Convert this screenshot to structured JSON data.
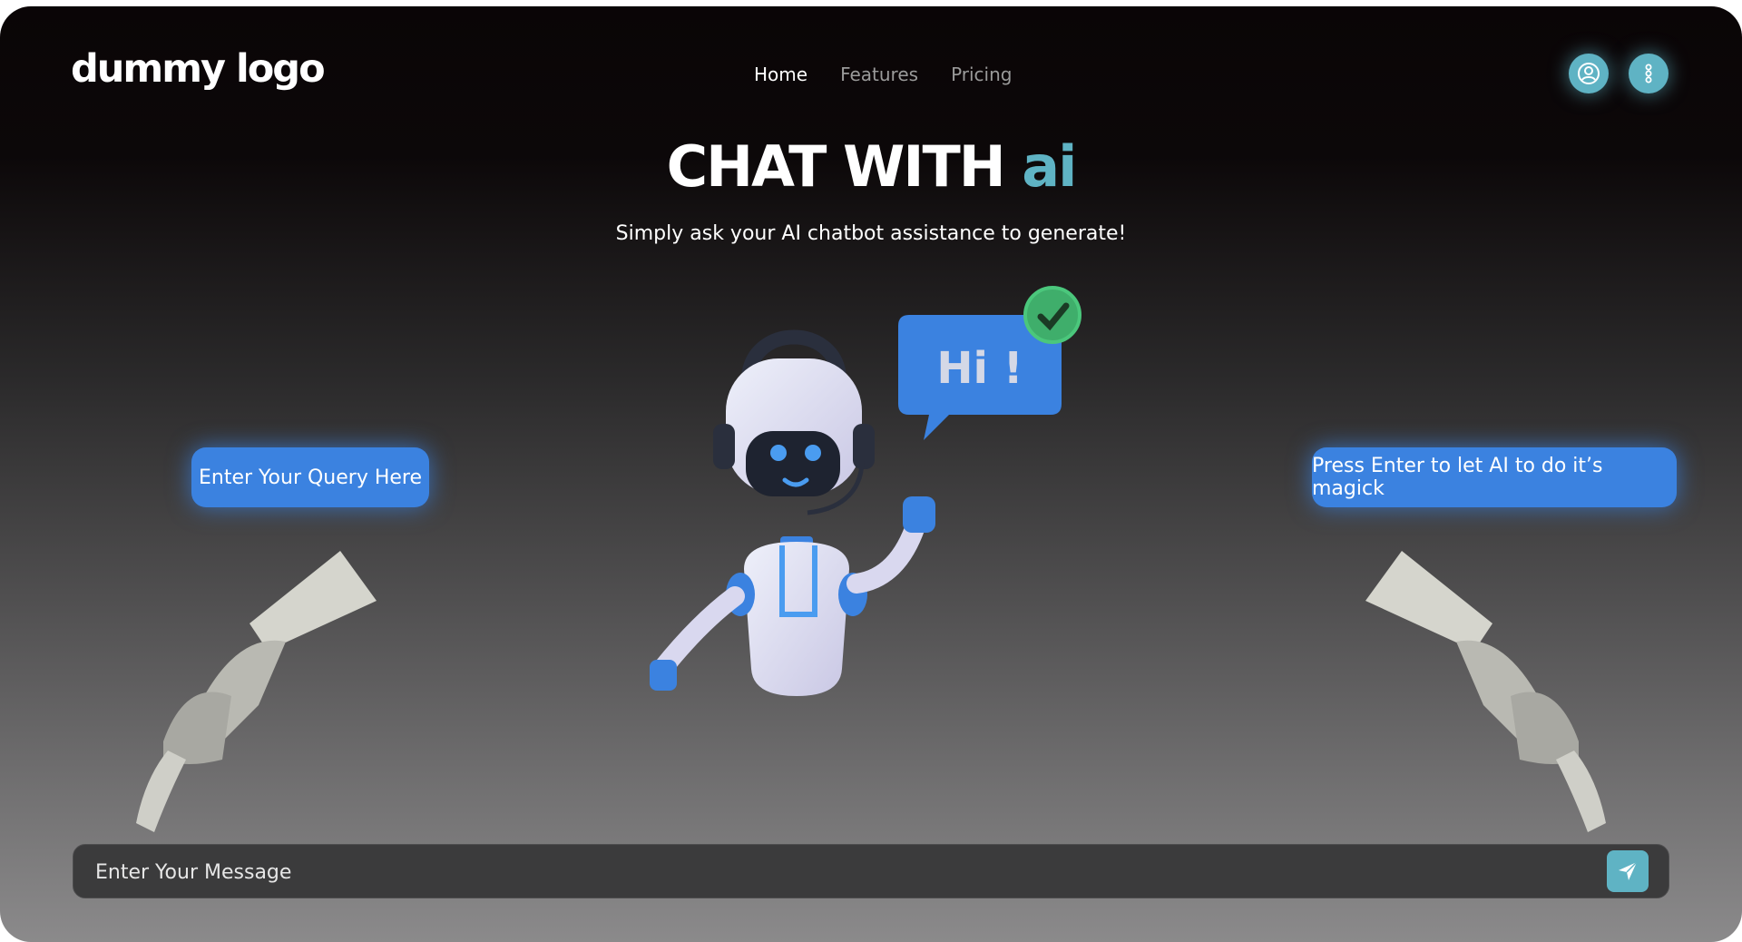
{
  "logo": {
    "text": "dummy logo"
  },
  "nav": {
    "items": [
      {
        "label": "Home",
        "active": true
      },
      {
        "label": "Features",
        "active": false
      },
      {
        "label": "Pricing",
        "active": false
      }
    ]
  },
  "header_icons": {
    "user": "user-circle-icon",
    "menu": "vertical-dots-icon"
  },
  "hero": {
    "title_main": "CHAT WITH ",
    "title_accent": "ai",
    "subtitle": "Simply ask your AI chatbot assistance to generate!"
  },
  "robot": {
    "speech_bubble": "Hi !"
  },
  "pills": {
    "left": "Enter Your Query Here",
    "right": "Press Enter to let AI to do it’s magick"
  },
  "message_bar": {
    "placeholder": "Enter Your Message"
  },
  "colors": {
    "accent_teal": "#5fb3c4",
    "accent_blue": "#3b82e0"
  }
}
